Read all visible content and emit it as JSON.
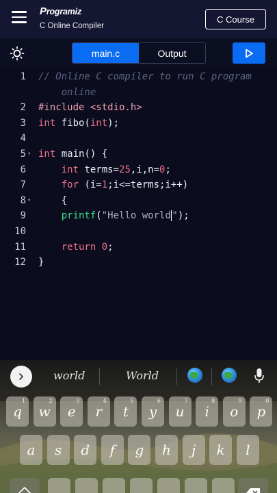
{
  "header": {
    "logo_text": "rogramiz",
    "logo_mark": "P",
    "subtitle": "C Online Compiler",
    "course_button": "C Course"
  },
  "toolbar": {
    "tabs": [
      {
        "label": "main.c",
        "active": true
      },
      {
        "label": "Output",
        "active": false
      }
    ]
  },
  "editor": {
    "lines": [
      {
        "n": "1",
        "tokens": [
          {
            "t": "// Online C compiler to run C program",
            "c": "cmt"
          }
        ]
      },
      {
        "n": "",
        "tokens": [
          {
            "t": "    online",
            "c": "cmt"
          }
        ]
      },
      {
        "n": "2",
        "tokens": [
          {
            "t": "#include <stdio.h>",
            "c": "pre"
          }
        ]
      },
      {
        "n": "3",
        "tokens": [
          {
            "t": "int",
            "c": "kw"
          },
          {
            "t": " fibo(",
            "c": ""
          },
          {
            "t": "int",
            "c": "kw"
          },
          {
            "t": ");",
            "c": ""
          }
        ]
      },
      {
        "n": "4",
        "tokens": []
      },
      {
        "n": "5",
        "fold": true,
        "tokens": [
          {
            "t": "int",
            "c": "kw"
          },
          {
            "t": " main() {",
            "c": ""
          }
        ]
      },
      {
        "n": "6",
        "tokens": [
          {
            "t": "    ",
            "c": ""
          },
          {
            "t": "int",
            "c": "kw"
          },
          {
            "t": " terms=",
            "c": ""
          },
          {
            "t": "25",
            "c": "num"
          },
          {
            "t": ",i,n=",
            "c": ""
          },
          {
            "t": "0",
            "c": "num"
          },
          {
            "t": ";",
            "c": ""
          }
        ]
      },
      {
        "n": "7",
        "tokens": [
          {
            "t": "    ",
            "c": ""
          },
          {
            "t": "for",
            "c": "kw"
          },
          {
            "t": " (i=",
            "c": ""
          },
          {
            "t": "1",
            "c": "num"
          },
          {
            "t": ";i<=terms;i++)",
            "c": ""
          }
        ]
      },
      {
        "n": "8",
        "fold": true,
        "tokens": [
          {
            "t": "    {",
            "c": ""
          }
        ]
      },
      {
        "n": "9",
        "tokens": [
          {
            "t": "    ",
            "c": ""
          },
          {
            "t": "printf",
            "c": "fn"
          },
          {
            "t": "(",
            "c": ""
          },
          {
            "t": "\"Hello world",
            "c": "str"
          },
          {
            "t": "|",
            "c": "cursor"
          },
          {
            "t": "\"",
            "c": "str"
          },
          {
            "t": ");",
            "c": ""
          }
        ]
      },
      {
        "n": "10",
        "tokens": []
      },
      {
        "n": "11",
        "tokens": [
          {
            "t": "    ",
            "c": ""
          },
          {
            "t": "return",
            "c": "kw"
          },
          {
            "t": " ",
            "c": ""
          },
          {
            "t": "0",
            "c": "num"
          },
          {
            "t": ";",
            "c": ""
          }
        ]
      },
      {
        "n": "12",
        "tokens": [
          {
            "t": "}",
            "c": ""
          }
        ]
      }
    ]
  },
  "keyboard": {
    "suggestions": [
      "world",
      "World"
    ],
    "row1": [
      {
        "k": "q",
        "h": "1"
      },
      {
        "k": "w",
        "h": "2"
      },
      {
        "k": "e",
        "h": "3"
      },
      {
        "k": "r",
        "h": "4"
      },
      {
        "k": "t",
        "h": "5"
      },
      {
        "k": "y",
        "h": "6"
      },
      {
        "k": "u",
        "h": "7"
      },
      {
        "k": "i",
        "h": "8"
      },
      {
        "k": "o",
        "h": "9"
      },
      {
        "k": "p",
        "h": "0"
      }
    ],
    "row2": [
      {
        "k": "a",
        "h": ""
      },
      {
        "k": "s",
        "h": ""
      },
      {
        "k": "d",
        "h": ""
      },
      {
        "k": "f",
        "h": ""
      },
      {
        "k": "g",
        "h": ""
      },
      {
        "k": "h",
        "h": ""
      },
      {
        "k": "j",
        "h": ""
      },
      {
        "k": "k",
        "h": ""
      },
      {
        "k": "l",
        "h": ""
      }
    ]
  },
  "colors": {
    "accent": "#0a6cf2",
    "background": "#0b0d1e",
    "keyword": "#f0708a",
    "function": "#3ee08a",
    "comment": "#5d6383"
  }
}
